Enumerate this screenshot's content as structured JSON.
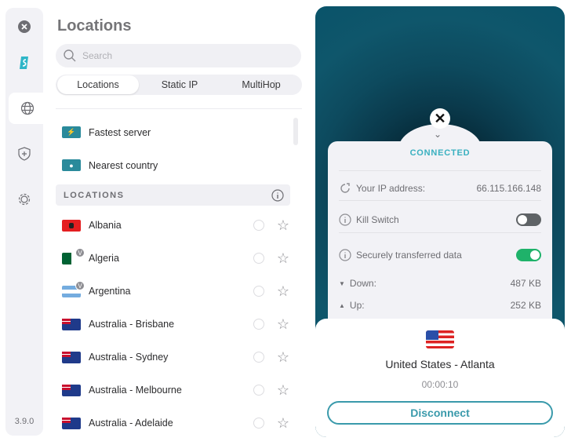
{
  "sidebar": {
    "version": "3.9.0",
    "items": [
      {
        "icon": "close-icon"
      },
      {
        "icon": "surfshark-logo"
      },
      {
        "icon": "globe-icon",
        "active": true
      },
      {
        "icon": "shield-plus-icon"
      },
      {
        "icon": "gear-icon"
      }
    ]
  },
  "header": {
    "title": "Locations"
  },
  "search": {
    "placeholder": "Search"
  },
  "tabs": [
    {
      "label": "Locations",
      "active": true
    },
    {
      "label": "Static IP"
    },
    {
      "label": "MultiHop"
    }
  ],
  "quick": [
    {
      "label": "Fastest server",
      "icon": "bolt-icon"
    },
    {
      "label": "Nearest country",
      "icon": "pin-icon"
    }
  ],
  "section": {
    "label": "LOCATIONS"
  },
  "locations": [
    {
      "name": "Albania",
      "virtual": false
    },
    {
      "name": "Algeria",
      "virtual": true
    },
    {
      "name": "Argentina",
      "virtual": true
    },
    {
      "name": "Australia - Brisbane",
      "virtual": false
    },
    {
      "name": "Australia - Sydney",
      "virtual": false
    },
    {
      "name": "Australia - Melbourne",
      "virtual": false
    },
    {
      "name": "Australia - Adelaide",
      "virtual": false
    }
  ],
  "virtual_badge": "V",
  "status": {
    "state": "CONNECTED",
    "ip_label": "Your IP address:",
    "ip": "66.115.166.148",
    "kill_switch_label": "Kill Switch",
    "kill_switch_on": false,
    "transfer_label": "Securely transferred data",
    "transfer_on": true,
    "down_label": "Down:",
    "down": "487 KB",
    "up_label": "Up:",
    "up": "252 KB"
  },
  "connection": {
    "location": "United States - Atlanta",
    "duration": "00:00:10",
    "disconnect_label": "Disconnect"
  },
  "colors": {
    "accent": "#3a9aab",
    "toggle_on": "#1fb26a",
    "toggle_off": "#5f6366"
  }
}
